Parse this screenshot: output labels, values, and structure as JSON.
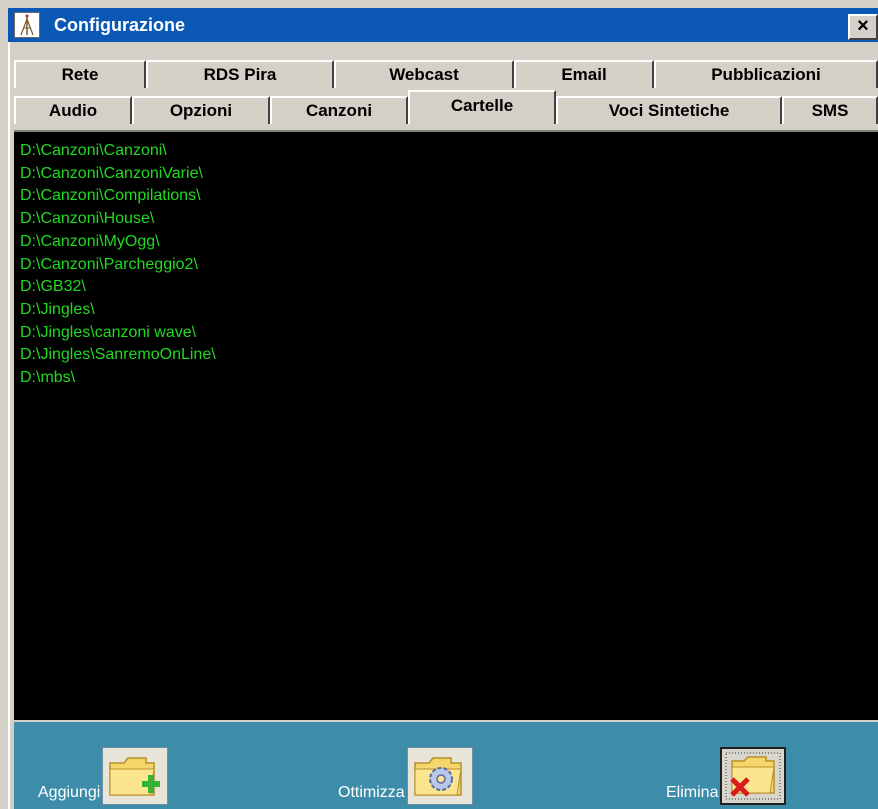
{
  "window": {
    "title": "Configurazione",
    "close_label": "×"
  },
  "tabs": {
    "row_top": [
      "Rete",
      "RDS Pira",
      "Webcast",
      "Email",
      "Pubblicazioni"
    ],
    "row_bottom": [
      "Audio",
      "Opzioni",
      "Canzoni",
      "Cartelle",
      "Voci Sintetiche",
      "SMS"
    ],
    "active": "Cartelle"
  },
  "folders": [
    "D:\\Canzoni\\Canzoni\\",
    "D:\\Canzoni\\CanzoniVarie\\",
    "D:\\Canzoni\\Compilations\\",
    "D:\\Canzoni\\House\\",
    "D:\\Canzoni\\MyOgg\\",
    "D:\\Canzoni\\Parcheggio2\\",
    "D:\\GB32\\",
    "D:\\Jingles\\",
    "D:\\Jingles\\canzoni wave\\",
    "D:\\Jingles\\SanremoOnLine\\",
    "D:\\mbs\\"
  ],
  "actions": {
    "add_label": "Aggiungi",
    "optimize_label": "Ottimizza",
    "delete_label": "Elimina"
  },
  "colors": {
    "titlebar": "#0a58b3",
    "list_bg": "#000000",
    "list_text": "#21d921",
    "bottom_bar": "#3d8daa"
  },
  "icons": {
    "app": "radio-tower-icon",
    "add": "folder-add-icon",
    "optimize": "folder-gear-icon",
    "delete": "folder-delete-icon"
  }
}
